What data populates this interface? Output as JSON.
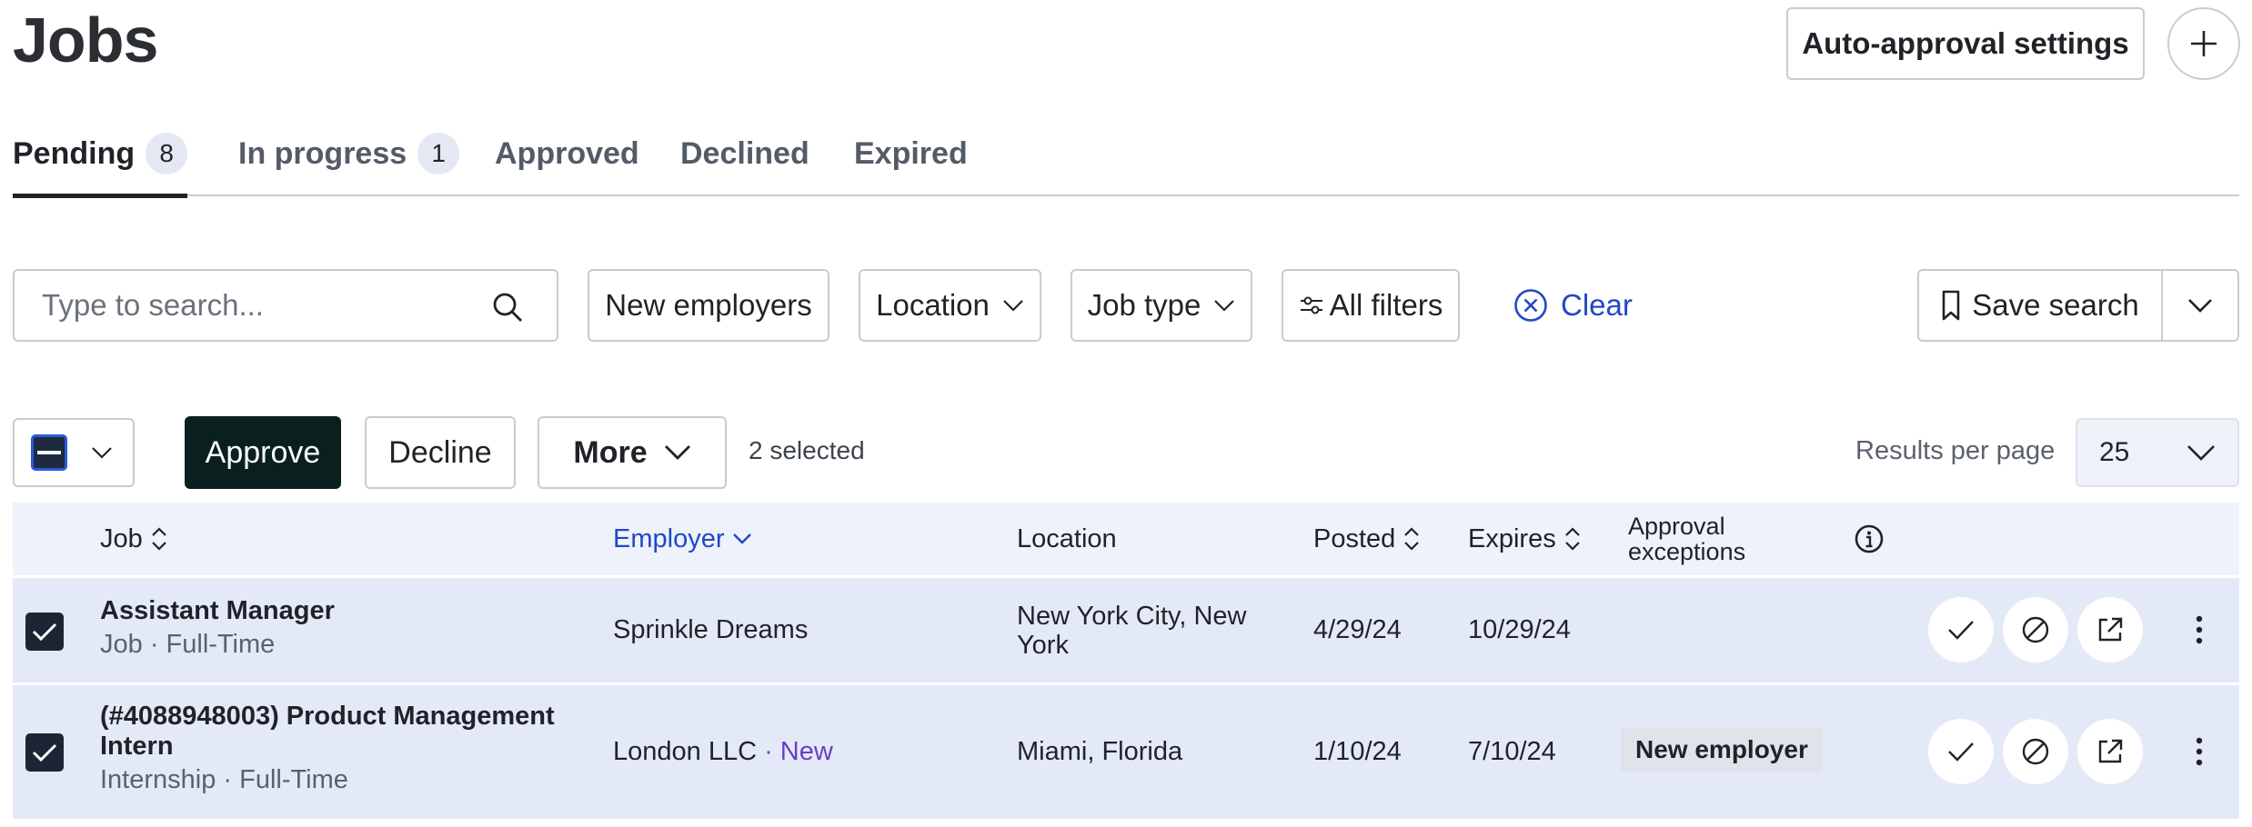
{
  "header": {
    "title": "Jobs",
    "auto_approval_label": "Auto-approval settings"
  },
  "tabs": [
    {
      "label": "Pending",
      "count": "8"
    },
    {
      "label": "In progress",
      "count": "1"
    },
    {
      "label": "Approved"
    },
    {
      "label": "Declined"
    },
    {
      "label": "Expired"
    }
  ],
  "filters": {
    "search_placeholder": "Type to search...",
    "new_employers": "New employers",
    "location": "Location",
    "job_type": "Job type",
    "all_filters": "All filters",
    "clear": "Clear",
    "save_search": "Save search"
  },
  "bulk": {
    "approve": "Approve",
    "decline": "Decline",
    "more": "More",
    "selected": "2 selected",
    "results_per_page_label": "Results per page",
    "results_per_page_value": "25"
  },
  "table": {
    "columns": {
      "job": "Job",
      "employer": "Employer",
      "location": "Location",
      "posted": "Posted",
      "expires": "Expires",
      "approval_exceptions_1": "Approval",
      "approval_exceptions_2": "exceptions"
    },
    "rows": [
      {
        "title": "Assistant Manager",
        "subtitle": "Job · Full-Time",
        "employer": "Sprinkle Dreams",
        "location_1": "New York City, New",
        "location_2": "York",
        "posted": "4/29/24",
        "expires": "10/29/24"
      },
      {
        "title_1": "(#4088948003) Product Management",
        "title_2": "Intern",
        "subtitle": "Internship · Full-Time",
        "employer": "London LLC",
        "employer_tag": "· New",
        "location": "Miami, Florida",
        "posted": "1/10/24",
        "expires": "7/10/24",
        "exception": "New employer"
      }
    ]
  }
}
